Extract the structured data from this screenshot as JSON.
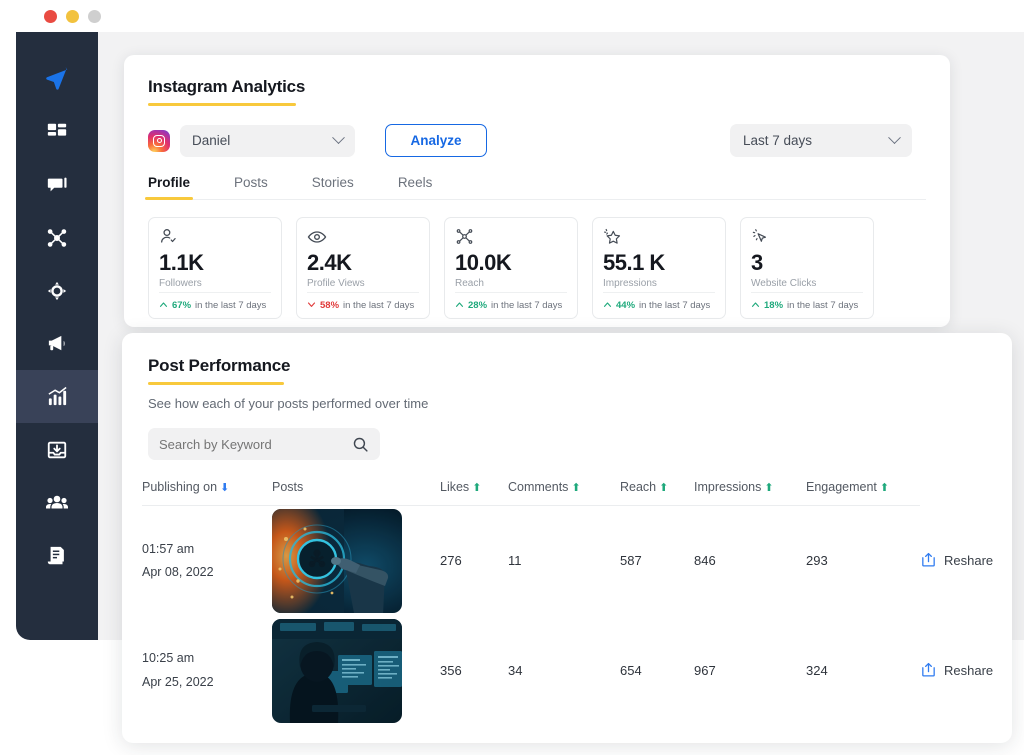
{
  "window": {
    "traffic_lights": [
      "close-red",
      "minimize-yellow",
      "zoom-grey"
    ]
  },
  "sidebar": {
    "items": [
      {
        "name": "logo-send",
        "icon": "paper-plane-icon",
        "active": false,
        "is_logo": true
      },
      {
        "name": "dashboard",
        "icon": "grid-dashboard-icon",
        "active": false
      },
      {
        "name": "messages",
        "icon": "chat-bubble-icon",
        "active": false
      },
      {
        "name": "network",
        "icon": "share-network-icon",
        "active": false
      },
      {
        "name": "targeting",
        "icon": "target-icon",
        "active": false
      },
      {
        "name": "campaigns",
        "icon": "megaphone-icon",
        "active": false
      },
      {
        "name": "analytics",
        "icon": "bar-chart-icon",
        "active": true
      },
      {
        "name": "inbox",
        "icon": "inbox-download-icon",
        "active": false
      },
      {
        "name": "team",
        "icon": "users-group-icon",
        "active": false
      },
      {
        "name": "reports",
        "icon": "document-icon",
        "active": false
      }
    ]
  },
  "analytics": {
    "title": "Instagram Analytics",
    "account_select": {
      "value": "Daniel",
      "icon": "instagram-icon"
    },
    "analyze_button": "Analyze",
    "date_range": {
      "value": "Last 7 days"
    },
    "tabs": [
      {
        "label": "Profile",
        "active": true
      },
      {
        "label": "Posts",
        "active": false
      },
      {
        "label": "Stories",
        "active": false
      },
      {
        "label": "Reels",
        "active": false
      }
    ],
    "stats": [
      {
        "icon": "user-check-icon",
        "value": "1.1K",
        "label": "Followers",
        "pct": "67%",
        "dir": "up",
        "period": "in the last 7 days"
      },
      {
        "icon": "eye-icon",
        "value": "2.4K",
        "label": "Profile Views",
        "pct": "58%",
        "dir": "down",
        "period": "in the last 7 days"
      },
      {
        "icon": "share-nodes-icon",
        "value": "10.0K",
        "label": "Reach",
        "pct": "28%",
        "dir": "up",
        "period": "in the last 7 days"
      },
      {
        "icon": "star-sparkle-icon",
        "value": "55.1 K",
        "label": "Impressions",
        "pct": "44%",
        "dir": "up",
        "period": "in the last 7 days"
      },
      {
        "icon": "cursor-click-icon",
        "value": "3",
        "label": "Website Clicks",
        "pct": "18%",
        "dir": "up",
        "period": "in the last 7 days"
      }
    ]
  },
  "post_performance": {
    "title": "Post Performance",
    "subtitle": "See how each of your posts performed over time",
    "search": {
      "placeholder": "Search by Keyword",
      "value": "",
      "icon": "search-icon"
    },
    "columns": [
      {
        "label": "Publishing on",
        "sort": "down",
        "sort_color": "blue"
      },
      {
        "label": "Posts",
        "sort": "none"
      },
      {
        "label": "Likes",
        "sort": "up",
        "sort_color": "green"
      },
      {
        "label": "Comments",
        "sort": "up",
        "sort_color": "green"
      },
      {
        "label": "Reach",
        "sort": "up",
        "sort_color": "green"
      },
      {
        "label": "Impressions",
        "sort": "up",
        "sort_color": "green"
      },
      {
        "label": "Engagement",
        "sort": "up",
        "sort_color": "green"
      }
    ],
    "rows": [
      {
        "time": "01:57 am",
        "date": "Apr 08, 2022",
        "thumb": "cyber-interface-hand-pointing",
        "likes": "276",
        "comments": "11",
        "reach": "587",
        "impressions": "846",
        "engagement": "293",
        "action": {
          "label": "Reshare",
          "icon": "reshare-icon"
        }
      },
      {
        "time": "10:25 am",
        "date": "Apr 25, 2022",
        "thumb": "hooded-figure-monitors",
        "likes": "356",
        "comments": "34",
        "reach": "654",
        "impressions": "967",
        "engagement": "324",
        "action": {
          "label": "Reshare",
          "icon": "reshare-icon"
        }
      }
    ]
  },
  "colors": {
    "accent_yellow": "#f8c93c",
    "accent_blue": "#1668e3",
    "sidebar_bg": "#242e3e",
    "sidebar_active": "#394258",
    "up_green": "#1fa97c",
    "down_red": "#e03a3a",
    "page_bg": "#f2f2f3"
  }
}
